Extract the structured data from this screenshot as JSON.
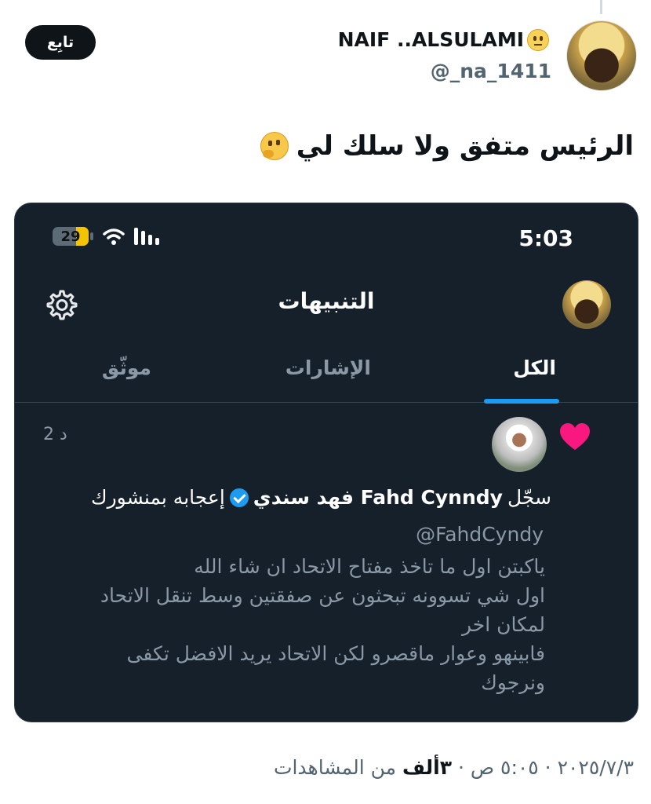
{
  "tweet": {
    "follow_label": "تابِع",
    "author_name": "NAIF ..ALSULAMI",
    "author_handle": "@_na_1411",
    "text": "الرئيس  متفق ولا سلك لي",
    "meta": {
      "date_time": "٢٠٢٥/٧/٣ · ٥:٠٥ ص · ",
      "views_count": "٣ألف",
      "views_label": " من المشاهدات"
    }
  },
  "screenshot": {
    "status_time": "5:03",
    "battery_level": "29",
    "title": "التنبيهات",
    "tabs": [
      "الكل",
      "الإشارات",
      "موثّق"
    ],
    "active_tab": 0,
    "notification": {
      "time_ago": "2 د",
      "prefix": "سجّل",
      "user_name": "Fahd Cynndy فهد سندي",
      "suffix": "إعجابه بمنشورك",
      "user_handle": "@FahdCyndy",
      "body": "ياكبتن اول ما تاخذ مفتاح الاتحاد ان شاء الله\nاول شي تسوونه تبحثون عن صفقتين وسط تنقل الاتحاد\nلمكان اخر\nفابينهو وعوار ماقصرو لكن الاتحاد يريد الافضل تكفى\nونرجوك"
    }
  },
  "icons": {
    "settings": "gear-icon",
    "like": "heart-icon",
    "verified": "verified-badge-icon",
    "wifi": "wifi-icon",
    "signal": "signal-icon",
    "battery": "battery-icon"
  },
  "colors": {
    "accent": "#1d9bf0",
    "heart": "#f91880",
    "dark_bg": "#15202b"
  }
}
